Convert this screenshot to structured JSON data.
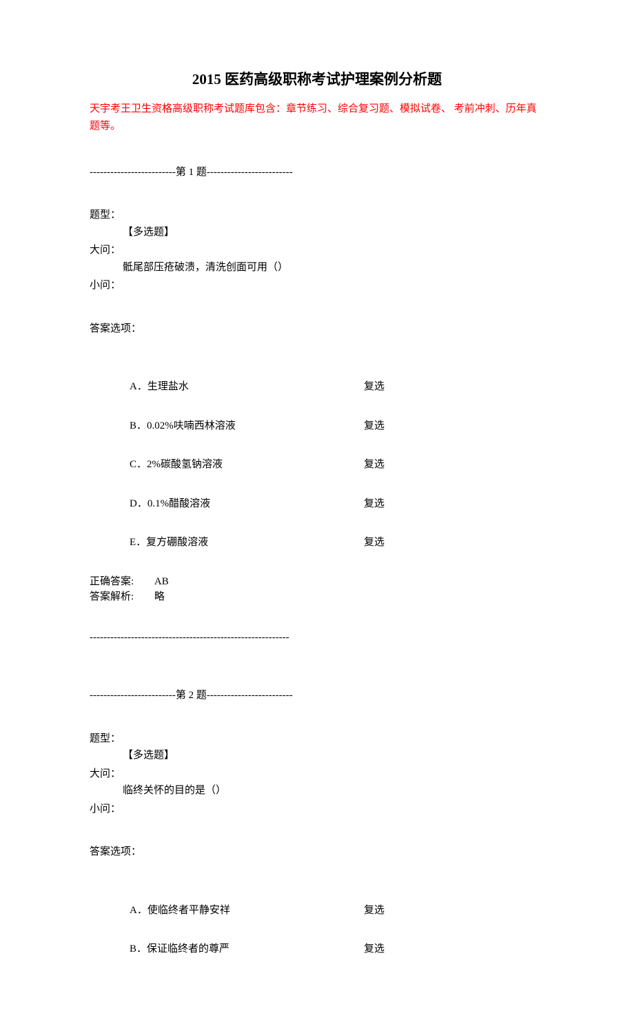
{
  "title": "2015 医药高级职称考试护理案例分析题",
  "intro": "天宇考王卫生资格高级职称考试题库包含：章节练习、综合复习题、模拟试卷、 考前冲刺、历年真题等。",
  "q1": {
    "sep": "-------------------------第 1 题-------------------------",
    "type_label": "题型：",
    "type_value": "【多选题】",
    "big_label": "大问：",
    "big_value": "骶尾部压疮破溃，清洗创面可用（）",
    "small_label": "小问：",
    "options_label": "答案选项：",
    "options": [
      {
        "text": "A．生理盐水",
        "check": "复选"
      },
      {
        "text": "B．0.02%呋喃西林溶液",
        "check": "复选"
      },
      {
        "text": "C．2%碳酸氢钠溶液",
        "check": "复选"
      },
      {
        "text": "D．0.1%醋酸溶液",
        "check": "复选"
      },
      {
        "text": "E．复方硼酸溶液",
        "check": "复选"
      }
    ],
    "answer_label": "正确答案:",
    "answer_value": "AB",
    "analysis_label": "答案解析:",
    "analysis_value": "略",
    "divider": "----------------------------------------------------------"
  },
  "q2": {
    "sep": "-------------------------第 2 题-------------------------",
    "type_label": "题型：",
    "type_value": "【多选题】",
    "big_label": "大问：",
    "big_value": "临终关怀的目的是（）",
    "small_label": "小问：",
    "options_label": "答案选项：",
    "options": [
      {
        "text": "A．使临终者平静安祥",
        "check": "复选"
      },
      {
        "text": "B．保证临终者的尊严",
        "check": "复选"
      }
    ]
  }
}
